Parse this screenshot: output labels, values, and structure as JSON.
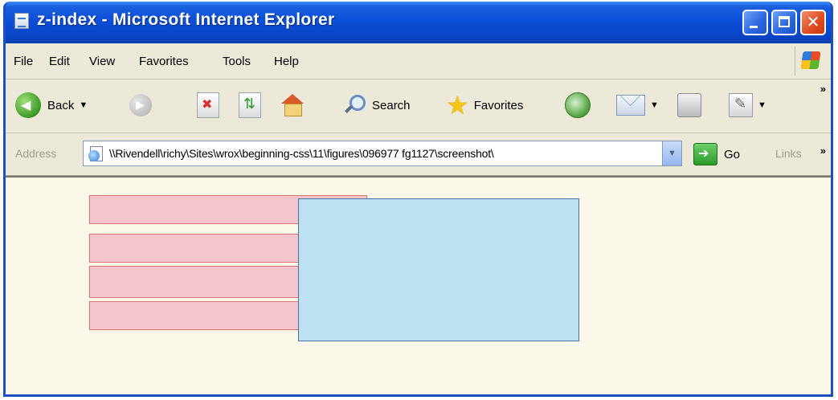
{
  "window": {
    "title": "z-index - Microsoft Internet Explorer",
    "close_glyph": "✕"
  },
  "menu": {
    "items": [
      "File",
      "Edit",
      "View",
      "Favorites",
      "Tools",
      "Help"
    ]
  },
  "toolbar": {
    "back_label": "Back",
    "search_label": "Search",
    "favorites_label": "Favorites",
    "overflow_chevron": "»"
  },
  "address_bar": {
    "label": "Address",
    "url": "\\\\Rivendell\\richy\\Sites\\wrox\\beginning-css\\11\\figures\\096977 fg1127\\screenshot\\",
    "go_label": "Go",
    "links_label": "Links",
    "overflow_chevron": "»"
  },
  "content": {
    "pink_boxes": 4,
    "blue_boxes": 1,
    "colors": {
      "page_background": "#fcf9ea",
      "pink_fill": "#f4c6cc",
      "pink_border": "#df7070",
      "blue_fill": "#bde2f1",
      "blue_border": "#4c6fae"
    }
  },
  "colors": {
    "titlebar": "#0c4ed8",
    "chrome": "#ece9d8"
  }
}
